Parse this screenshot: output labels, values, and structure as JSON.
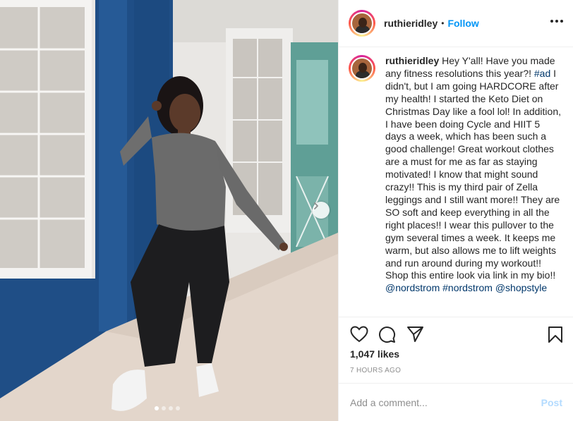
{
  "post": {
    "username": "ruthieridley",
    "follow_label": "Follow",
    "separator": "•",
    "caption_user": "ruthieridley",
    "caption_segments": [
      {
        "type": "text",
        "value": " Hey Y'all! Have you made any fitness resolutions this year?! "
      },
      {
        "type": "tag",
        "value": "#ad"
      },
      {
        "type": "text",
        "value": " I didn't, but I am going HARDCORE after my health! I started the Keto Diet on Christmas Day like a fool lol! In addition, I have been doing Cycle and HIIT 5 days a week, which has been such a good challenge! Great workout clothes are a must for me as far as staying motivated! I know that might sound crazy!! This is my third pair of Zella leggings and I still want more!! They are SO soft and keep everything in all the right places!! I wear this pullover to the gym several times a week. It keeps me warm, but also allows me to lift weights and run around during my workout!! Shop this entire look via link in my bio!! "
      },
      {
        "type": "tag",
        "value": "@nordstrom"
      },
      {
        "type": "text",
        "value": " "
      },
      {
        "type": "tag",
        "value": "#nordstrom"
      },
      {
        "type": "text",
        "value": " "
      },
      {
        "type": "tag",
        "value": "@shopstyle"
      }
    ],
    "likes": "1,047 likes",
    "timestamp": "7 HOURS AGO",
    "comment_placeholder": "Add a comment...",
    "post_label": "Post",
    "carousel": {
      "total": 4,
      "active_index": 0
    }
  },
  "icons": {
    "like": "heart-icon",
    "comment": "comment-icon",
    "share": "share-icon",
    "save": "bookmark-icon",
    "more": "more-options-icon",
    "next": "chevron-right-icon"
  },
  "colors": {
    "link_blue": "#0095f6",
    "tag_blue": "#00376b",
    "muted": "#8e8e8e",
    "post_disabled": "#b3dbff"
  }
}
